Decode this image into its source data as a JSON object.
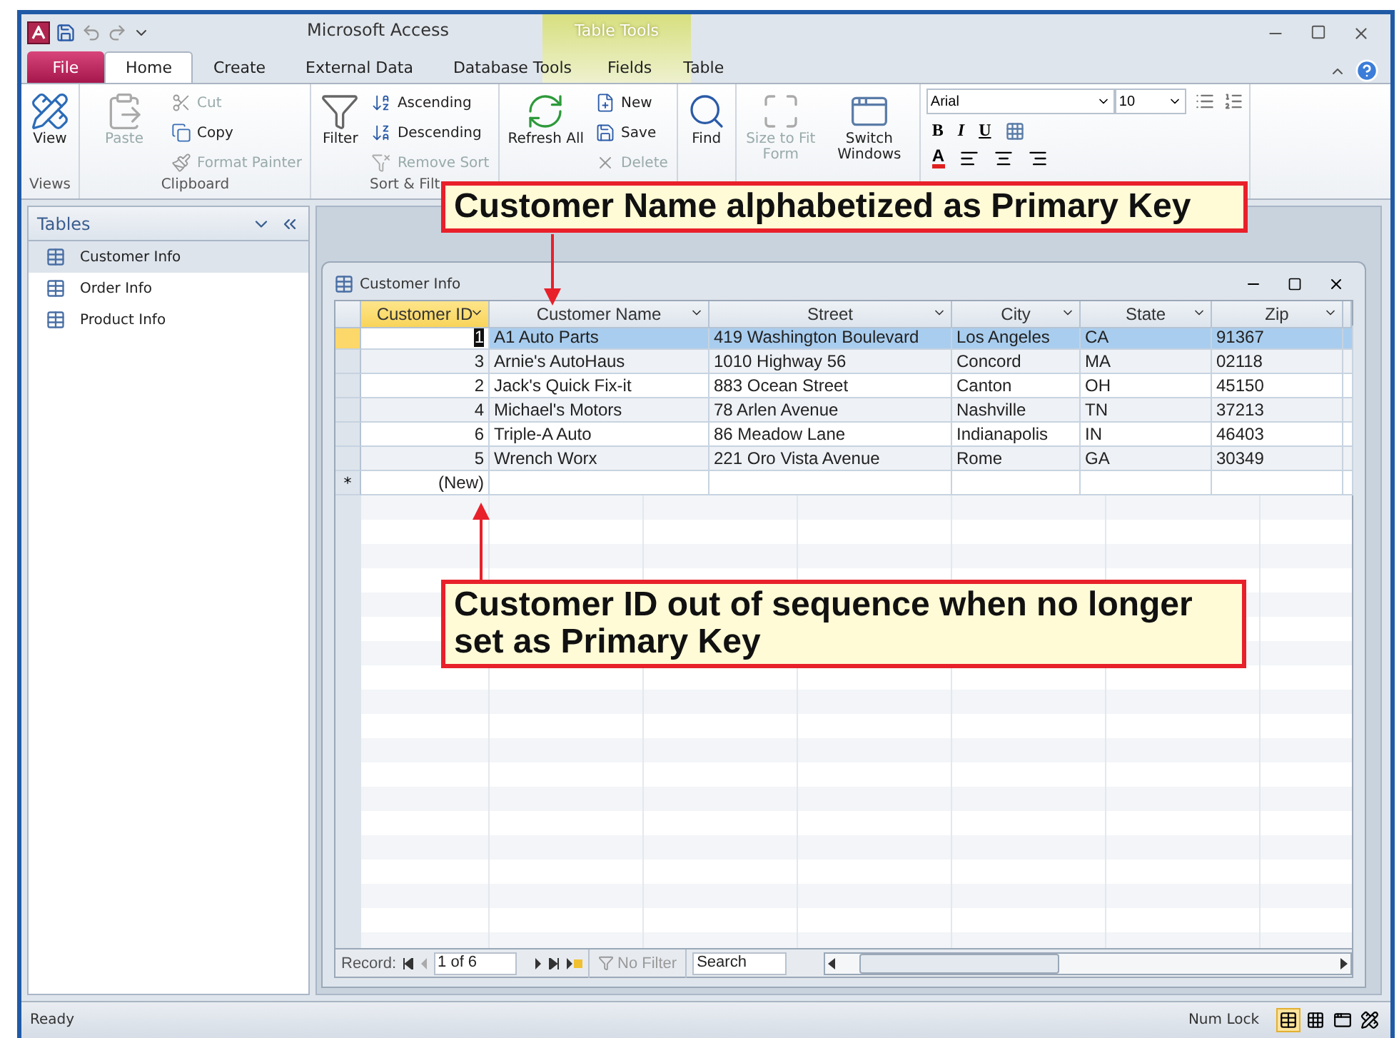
{
  "title_bar": {
    "title": "Microsoft Access",
    "contextual_tab": "Table Tools"
  },
  "ribbon_tabs": [
    {
      "label": "File",
      "kind": "file",
      "selected": false
    },
    {
      "label": "Home",
      "kind": "normal",
      "selected": true
    },
    {
      "label": "Create",
      "kind": "normal",
      "selected": false
    },
    {
      "label": "External Data",
      "kind": "normal",
      "selected": false
    },
    {
      "label": "Database Tools",
      "kind": "normal",
      "selected": false
    },
    {
      "label": "Fields",
      "kind": "contextual",
      "selected": false
    },
    {
      "label": "Table",
      "kind": "contextual",
      "selected": false
    }
  ],
  "ribbon_groups": [
    {
      "label": "Views",
      "items": [
        {
          "kind": "large",
          "label": "View",
          "disabled": false
        }
      ]
    },
    {
      "label": "Clipboard",
      "items": [
        {
          "kind": "large",
          "label": "Paste",
          "disabled": true
        },
        {
          "kind": "small",
          "label": "Cut",
          "disabled": true
        },
        {
          "kind": "small",
          "label": "Copy",
          "disabled": false
        },
        {
          "kind": "small",
          "label": "Format Painter",
          "disabled": true
        }
      ]
    },
    {
      "label": "Sort & Filt",
      "items": [
        {
          "kind": "large",
          "label": "Filter",
          "disabled": false
        },
        {
          "kind": "small",
          "label": "Ascending",
          "disabled": false
        },
        {
          "kind": "small",
          "label": "Descending",
          "disabled": false
        },
        {
          "kind": "small",
          "label": "Remove Sort",
          "disabled": true
        }
      ]
    },
    {
      "items": [
        {
          "kind": "large",
          "label": "Refresh All",
          "disabled": false
        },
        {
          "kind": "small",
          "label": "New",
          "disabled": false
        },
        {
          "kind": "small",
          "label": "Save",
          "disabled": false
        },
        {
          "kind": "small",
          "label": "Delete",
          "disabled": true
        }
      ]
    },
    {
      "items": [
        {
          "kind": "large",
          "label": "Find",
          "disabled": false
        }
      ]
    },
    {
      "items": [
        {
          "kind": "large",
          "label": "Size to Fit Form",
          "disabled": true
        },
        {
          "kind": "large",
          "label": "Switch Windows",
          "disabled": false
        }
      ]
    }
  ],
  "text_formatting": {
    "font": "Arial",
    "size": "10",
    "bold": "B",
    "italic": "I",
    "underline": "U",
    "font_color": "A"
  },
  "navigation": {
    "title": "Tables",
    "items": [
      {
        "label": "Customer Info",
        "selected": true
      },
      {
        "label": "Order Info",
        "selected": false
      },
      {
        "label": "Product Info",
        "selected": false
      }
    ]
  },
  "document": {
    "title": "Customer Info",
    "columns": [
      {
        "label": "Customer ID",
        "selected": true
      },
      {
        "label": "Customer Name",
        "selected": false
      },
      {
        "label": "Street",
        "selected": false
      },
      {
        "label": "City",
        "selected": false
      },
      {
        "label": "State",
        "selected": false
      },
      {
        "label": "Zip",
        "selected": false
      }
    ],
    "rows": [
      {
        "selected": true,
        "cells": [
          "1",
          "A1 Auto Parts",
          "419 Washington Boulevard",
          "Los Angeles",
          "CA",
          "91367"
        ]
      },
      {
        "selected": false,
        "cells": [
          "3",
          "Arnie's AutoHaus",
          "1010 Highway 56",
          "Concord",
          "MA",
          "02118"
        ]
      },
      {
        "selected": false,
        "cells": [
          "2",
          "Jack's Quick Fix-it",
          "883 Ocean Street",
          "Canton",
          "OH",
          "45150"
        ]
      },
      {
        "selected": false,
        "cells": [
          "4",
          "Michael's Motors",
          "78 Arlen Avenue",
          "Nashville",
          "TN",
          "37213"
        ]
      },
      {
        "selected": false,
        "cells": [
          "6",
          "Triple-A Auto",
          "86 Meadow Lane",
          "Indianapolis",
          "IN",
          "46403"
        ]
      },
      {
        "selected": false,
        "cells": [
          "5",
          "Wrench Worx",
          "221 Oro Vista Avenue",
          "Rome",
          "GA",
          "30349"
        ]
      }
    ],
    "new_row": {
      "marker": "*",
      "label": "(New)"
    },
    "record_nav": {
      "label": "Record:",
      "position": "1 of 6",
      "filter": "No Filter",
      "search": "Search"
    }
  },
  "status_bar": {
    "text": "Ready",
    "indicator": "Num Lock"
  },
  "callouts": [
    {
      "text": "Customer Name alphabetized as Primary Key"
    },
    {
      "text": "Customer ID out of sequence when no longer set as Primary Key"
    }
  ]
}
